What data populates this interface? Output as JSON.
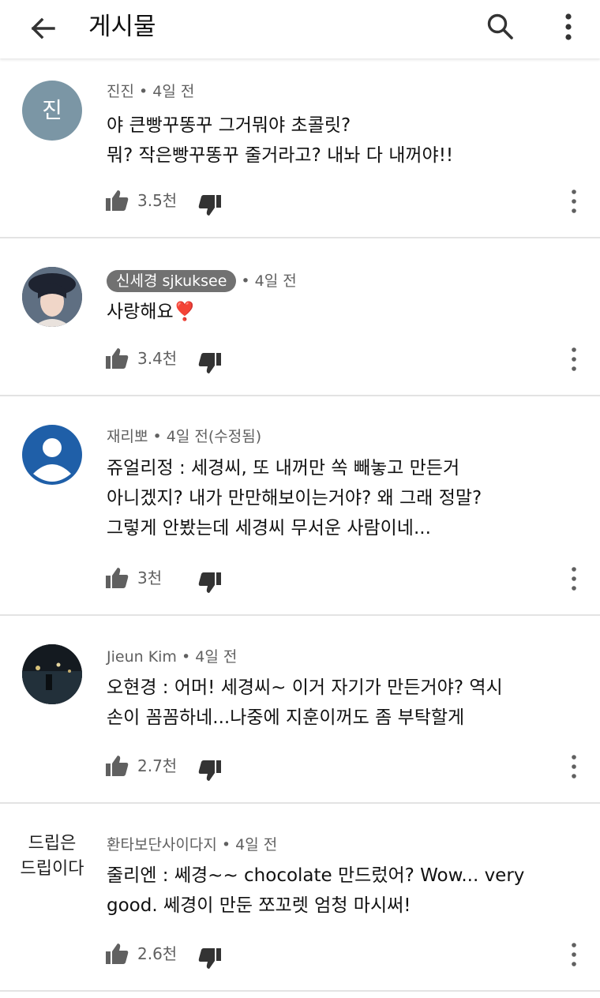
{
  "header": {
    "title": "게시물",
    "back_icon": "arrow-left-icon",
    "search_icon": "search-icon",
    "more_icon": "more-vert-icon"
  },
  "comments": [
    {
      "author": "진진",
      "time": "4일 전",
      "avatar_letter": "진",
      "avatar_color": "#7b96a5",
      "lines": [
        "야 큰빵꾸똥꾸 그거뭐야 초콜릿?",
        "뭐? 작은빵꾸똥꾸 줄거라고? 내놔 다 내꺼야!!"
      ],
      "likes": "3.5천"
    },
    {
      "author": "신세경 sjkuksee",
      "time": "4일 전",
      "is_channel_owner": true,
      "lines": [
        "사랑해요❣️"
      ],
      "likes": "3.4천"
    },
    {
      "author": "재리뽀",
      "time": "4일 전(수정됨)",
      "avatar_color": "#1f5fa8",
      "lines": [
        "쥬얼리정 : 세경씨, 또 내꺼만 쏙 빼놓고 만든거",
        "아니겠지? 내가 만만해보이는거야? 왜 그래 정말?",
        "그렇게 안봤는데 세경씨 무서운 사람이네..."
      ],
      "likes": "3천"
    },
    {
      "author": "Jieun Kim",
      "time": "4일 전",
      "lines": [
        "오현경 : 어머! 세경씨~ 이거 자기가 만든거야? 역시",
        "손이 꼼꼼하네...나중에 지훈이꺼도 좀 부탁할게"
      ],
      "likes": "2.7천"
    },
    {
      "author": "환타보단사이다지",
      "time": "4일 전",
      "avatar_text": [
        "드립은",
        "드립이다"
      ],
      "lines": [
        "줄리엔 : 쎄경~~ chocolate 만드렀어? Wow... very",
        "good. 쎄경이 만둔 쪼꼬렛 엄청 마시써!"
      ],
      "likes": "2.6천"
    }
  ]
}
